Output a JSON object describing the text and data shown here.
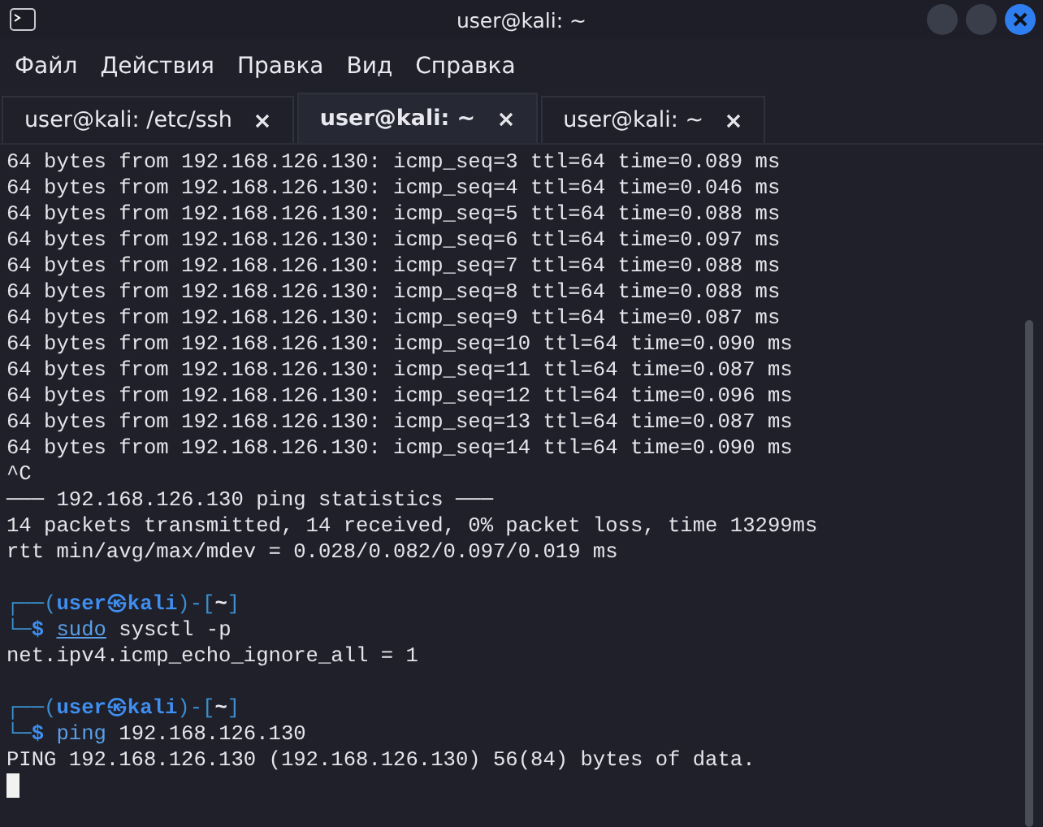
{
  "window": {
    "title": "user@kali: ~"
  },
  "menu": [
    "Файл",
    "Действия",
    "Правка",
    "Вид",
    "Справка"
  ],
  "tabs": [
    {
      "label": "user@kali: /etc/ssh",
      "selected": false
    },
    {
      "label": "user@kali: ~",
      "selected": true
    },
    {
      "label": "user@kali: ~",
      "selected": false
    }
  ],
  "terminal": {
    "lines": [
      {
        "kind": "output",
        "text": "64 bytes from 192.168.126.130: icmp_seq=3 ttl=64 time=0.089 ms"
      },
      {
        "kind": "output",
        "text": "64 bytes from 192.168.126.130: icmp_seq=4 ttl=64 time=0.046 ms"
      },
      {
        "kind": "output",
        "text": "64 bytes from 192.168.126.130: icmp_seq=5 ttl=64 time=0.088 ms"
      },
      {
        "kind": "output",
        "text": "64 bytes from 192.168.126.130: icmp_seq=6 ttl=64 time=0.097 ms"
      },
      {
        "kind": "output",
        "text": "64 bytes from 192.168.126.130: icmp_seq=7 ttl=64 time=0.088 ms"
      },
      {
        "kind": "output",
        "text": "64 bytes from 192.168.126.130: icmp_seq=8 ttl=64 time=0.088 ms"
      },
      {
        "kind": "output",
        "text": "64 bytes from 192.168.126.130: icmp_seq=9 ttl=64 time=0.087 ms"
      },
      {
        "kind": "output",
        "text": "64 bytes from 192.168.126.130: icmp_seq=10 ttl=64 time=0.090 ms"
      },
      {
        "kind": "output",
        "text": "64 bytes from 192.168.126.130: icmp_seq=11 ttl=64 time=0.087 ms"
      },
      {
        "kind": "output",
        "text": "64 bytes from 192.168.126.130: icmp_seq=12 ttl=64 time=0.096 ms"
      },
      {
        "kind": "output",
        "text": "64 bytes from 192.168.126.130: icmp_seq=13 ttl=64 time=0.087 ms"
      },
      {
        "kind": "output",
        "text": "64 bytes from 192.168.126.130: icmp_seq=14 ttl=64 time=0.090 ms"
      },
      {
        "kind": "output",
        "text": "^C"
      },
      {
        "kind": "output",
        "text": "─── 192.168.126.130 ping statistics ───"
      },
      {
        "kind": "output",
        "text": "14 packets transmitted, 14 received, 0% packet loss, time 13299ms"
      },
      {
        "kind": "output",
        "text": "rtt min/avg/max/mdev = 0.028/0.082/0.097/0.019 ms"
      },
      {
        "kind": "blank"
      },
      {
        "kind": "prompt",
        "parts": [
          {
            "kind": "frame",
            "text": "┌──("
          },
          {
            "kind": "user",
            "text": "user㉿kali"
          },
          {
            "kind": "frame",
            "text": ")-["
          },
          {
            "kind": "dir",
            "text": "~"
          },
          {
            "kind": "frame",
            "text": "]"
          }
        ]
      },
      {
        "kind": "prompt",
        "parts": [
          {
            "kind": "frame",
            "text": "└─"
          },
          {
            "kind": "sign",
            "text": "$"
          },
          {
            "kind": "command",
            "text": "sudo",
            "underlined": true
          },
          {
            "kind": "args",
            "text": "sysctl -p"
          }
        ]
      },
      {
        "kind": "output",
        "text": "net.ipv4.icmp_echo_ignore_all = 1"
      },
      {
        "kind": "blank"
      },
      {
        "kind": "prompt",
        "parts": [
          {
            "kind": "frame",
            "text": "┌──("
          },
          {
            "kind": "user",
            "text": "user㉿kali"
          },
          {
            "kind": "frame",
            "text": ")-["
          },
          {
            "kind": "dir",
            "text": "~"
          },
          {
            "kind": "frame",
            "text": "]"
          }
        ]
      },
      {
        "kind": "prompt",
        "parts": [
          {
            "kind": "frame",
            "text": "└─"
          },
          {
            "kind": "sign",
            "text": "$"
          },
          {
            "kind": "command",
            "text": "ping",
            "underlined": false
          },
          {
            "kind": "args",
            "text": "192.168.126.130"
          }
        ]
      },
      {
        "kind": "output",
        "text": "PING 192.168.126.130 (192.168.126.130) 56(84) bytes of data."
      },
      {
        "kind": "cursor"
      }
    ]
  }
}
